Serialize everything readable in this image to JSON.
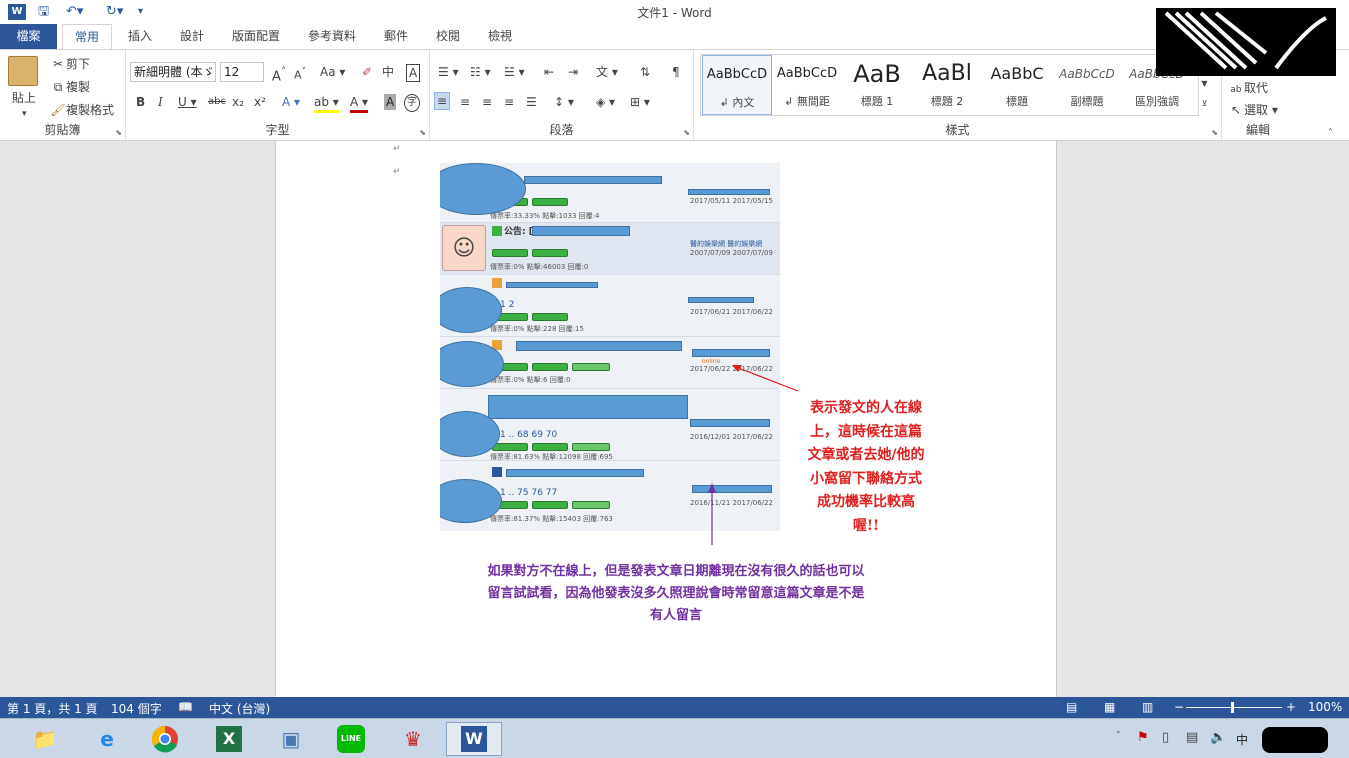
{
  "window": {
    "title": "文件1 - Word"
  },
  "tabs": [
    {
      "label": "檔案"
    },
    {
      "label": "常用"
    },
    {
      "label": "插入"
    },
    {
      "label": "設計"
    },
    {
      "label": "版面配置"
    },
    {
      "label": "參考資料"
    },
    {
      "label": "郵件"
    },
    {
      "label": "校閱"
    },
    {
      "label": "檢視"
    }
  ],
  "clipboard": {
    "paste": "貼上",
    "cut": "剪下",
    "copy": "複製",
    "format_painter": "複製格式",
    "group": "剪貼簿"
  },
  "font": {
    "name": "新細明體 (本ゞ",
    "size": "12",
    "group": "字型"
  },
  "paragraph": {
    "group": "段落"
  },
  "styles": {
    "group": "樣式",
    "items": [
      {
        "preview": "AaBbCcD",
        "name": "↲ 內文"
      },
      {
        "preview": "AaBbCcD",
        "name": "↲ 無間距"
      },
      {
        "preview": "AaB",
        "name": "標題 1"
      },
      {
        "preview": "AaBl",
        "name": "標題 2"
      },
      {
        "preview": "AaBbC",
        "name": "標題"
      },
      {
        "preview": "AaBbCcD",
        "name": "副標題"
      },
      {
        "preview": "AaBbCcD",
        "name": "區別強調"
      }
    ]
  },
  "editing": {
    "replace": "取代",
    "select": "選取",
    "group": "編輯"
  },
  "document": {
    "rows": [
      {
        "stats": "傳票率:33.33%  點擊:1033  回覆:4",
        "dates": "2017/05/11  2017/05/15"
      },
      {
        "title": "公告: [",
        "stats": "傳票率:0%  點擊:46003  回覆:0",
        "dates": "2007/07/09  2007/07/09",
        "users": "醫的娛樂網  醫的娛樂網"
      },
      {
        "pages": "1 2",
        "stats": "傳票率:0%  點擊:228  回覆:15",
        "dates": "2017/06/21  2017/06/22"
      },
      {
        "stats": "傳票率:0%  點擊:6  回覆:0",
        "dates": "2017/06/22  2017/06/22"
      },
      {
        "pages": "1 .. 68 69 70",
        "stats": "傳票率:81.63%  點擊:12098  回覆:695",
        "dates": "2016/12/01  2017/06/22"
      },
      {
        "pages": "1 .. 75 76 77",
        "stats": "傳票率:81.37%  點擊:15403  回覆:763",
        "dates": "2016/11/21  2017/06/22"
      }
    ],
    "online_tag": "online",
    "annotation_red": [
      "表示發文的人在線",
      "上，這時候在這篇",
      "文章或者去她/他的",
      "小窩留下聯絡方式",
      "成功機率比較高",
      "喔!!"
    ],
    "annotation_purple": [
      "如果對方不在線上，但是發表文章日期離現在沒有很久的話也可以",
      "留言試試看，因為他發表沒多久照理說會時常留意這篇文章是不是",
      "有人留言"
    ],
    "para_mark": "↵"
  },
  "status": {
    "page": "第 1 頁，共 1 頁",
    "words": "104 個字",
    "lang": "中文 (台灣)",
    "zoom": "100%"
  },
  "tray": {
    "ime": "中"
  }
}
